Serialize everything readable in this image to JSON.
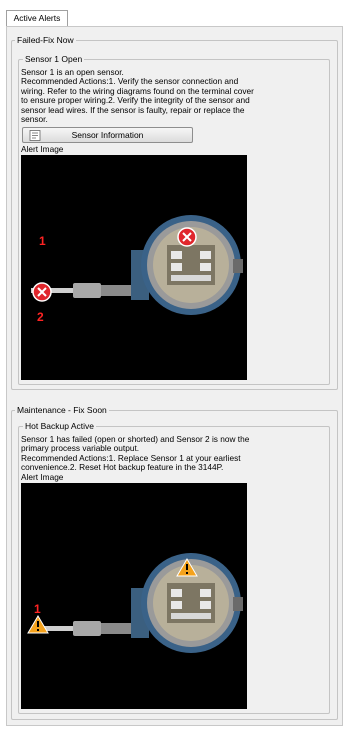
{
  "tabs": [
    {
      "label": "Active Alerts"
    }
  ],
  "failed_group": {
    "title": "Failed-Fix Now",
    "alert": {
      "title": "Sensor 1 Open",
      "lines": [
        "Sensor 1 is an open sensor.",
        "Recommended Actions:1. Verify the sensor connection and",
        "wiring.  Refer to the wiring diagrams found on the terminal cover",
        "to ensure proper wiring.2. Verify the integrity of the sensor and",
        "sensor lead wires.  If the sensor is faulty, repair or replace the",
        "sensor."
      ],
      "button_label": "Sensor Information",
      "image_label": "Alert Image",
      "markers": [
        "1",
        "2"
      ]
    }
  },
  "maintenance_group": {
    "title": "Maintenance - Fix Soon",
    "alert": {
      "title": "Hot Backup Active",
      "lines": [
        "Sensor 1 has failed (open or shorted) and Sensor 2 is now the",
        "primary process variable output.",
        "Recommended Actions:1. Replace Sensor 1 at your earliest",
        "convenience.2. Reset Hot backup feature in the 3144P."
      ],
      "image_label": "Alert Image",
      "markers": [
        "1"
      ]
    }
  },
  "colors": {
    "error": "#e0262c",
    "warning": "#f4a21c",
    "image_bg": "#000000"
  }
}
